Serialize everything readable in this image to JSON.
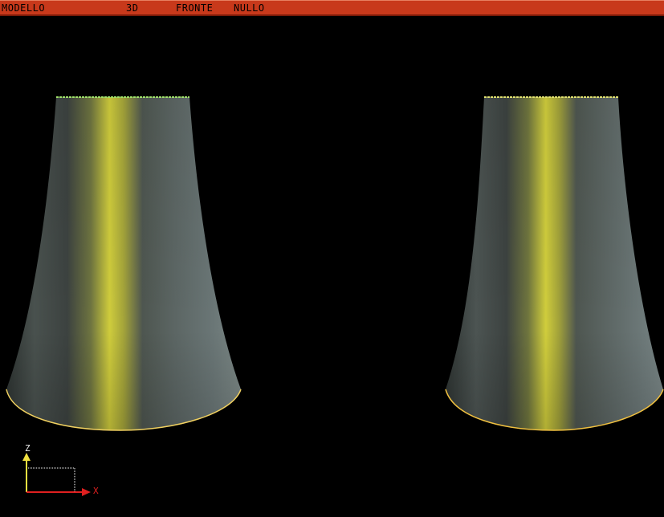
{
  "titlebar": {
    "mode": "MODELLO",
    "dimension": "3D",
    "view": "FRONTE",
    "status": "NULLO"
  },
  "axes": {
    "z_label": "Z",
    "x_label": "X"
  },
  "colors": {
    "titlebar_bg": "#c8391b",
    "viewport_bg": "#000000",
    "surface_highlight": "#c9c83a",
    "surface_base": "#5c6460",
    "rim_top": "#9fe06a",
    "rim_bottom": "#f0d060",
    "axis_z": "#f0e040",
    "axis_x": "#e02020"
  },
  "objects": [
    {
      "name": "revolved-surface-left"
    },
    {
      "name": "revolved-surface-right"
    }
  ]
}
